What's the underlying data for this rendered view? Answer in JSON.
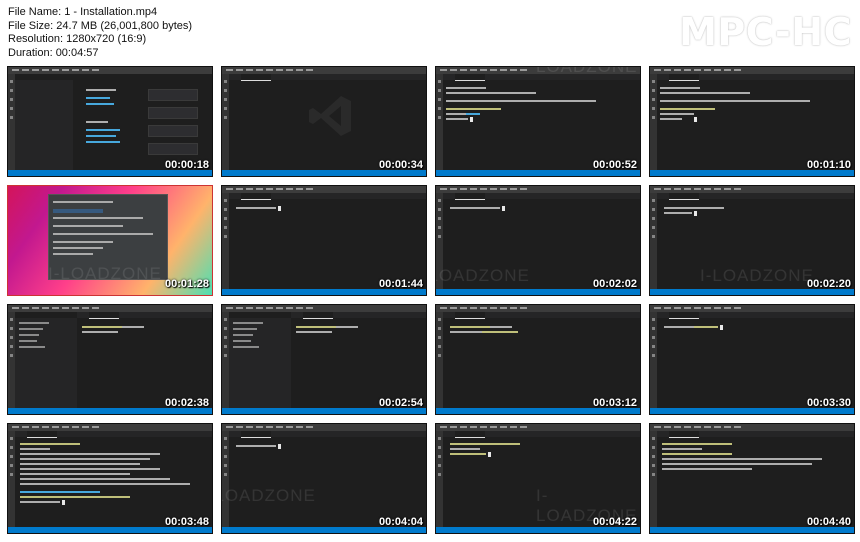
{
  "header": {
    "file_name": "File Name: 1 - Installation.mp4",
    "file_size": "File Size: 24.7 MB (26,001,800 bytes)",
    "resolution": "Resolution: 1280x720 (16:9)",
    "duration": "Duration: 00:04:57"
  },
  "brand": "MPC-HC",
  "watermark": "I-LOADZONE",
  "thumbnails": [
    {
      "time": "00:00:18"
    },
    {
      "time": "00:00:34"
    },
    {
      "time": "00:00:52"
    },
    {
      "time": "00:01:10"
    },
    {
      "time": "00:01:28"
    },
    {
      "time": "00:01:44"
    },
    {
      "time": "00:02:02"
    },
    {
      "time": "00:02:20"
    },
    {
      "time": "00:02:38"
    },
    {
      "time": "00:02:54"
    },
    {
      "time": "00:03:12"
    },
    {
      "time": "00:03:30"
    },
    {
      "time": "00:03:48"
    },
    {
      "time": "00:04:04"
    },
    {
      "time": "00:04:22"
    },
    {
      "time": "00:04:40"
    }
  ],
  "colors": {
    "editor_bg": "#1e1e1e",
    "status_bar": "#007acc",
    "title_bar": "#3c3c3c"
  }
}
